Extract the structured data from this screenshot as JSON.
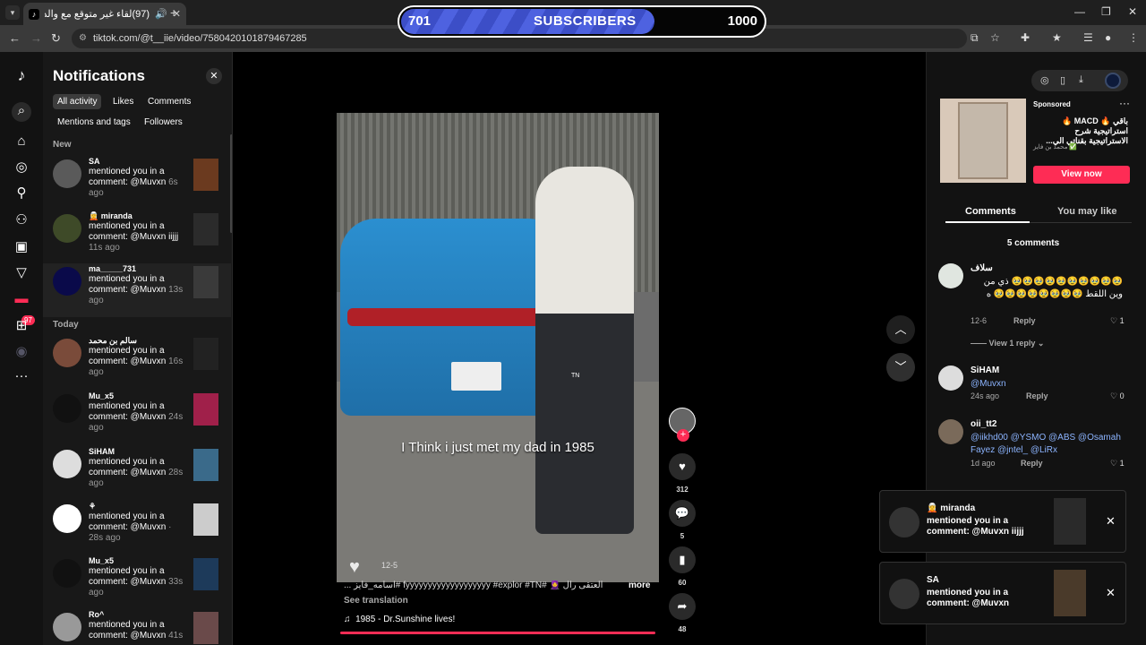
{
  "browser": {
    "tab_title": "(97)لقاء غير متوقع مع والدي",
    "url": "tiktok.com/@t__iie/video/7580420101879467285"
  },
  "subscribers": {
    "current": "701",
    "label": "SUBSCRIBERS",
    "goal": "1000",
    "progress": 0.701
  },
  "rail": {
    "badge": "97"
  },
  "notifications": {
    "title": "Notifications",
    "filters": [
      "All activity",
      "Likes",
      "Comments",
      "Mentions and tags",
      "Followers"
    ],
    "section_new": "New",
    "section_today": "Today",
    "items": [
      {
        "name": "SA",
        "text": "mentioned you in a comment: @Muvxn",
        "time": "6s ago"
      },
      {
        "name": "🧝 miranda",
        "text": "mentioned you in a comment: @Muvxn iijjj",
        "time": "11s ago"
      },
      {
        "name": "ma_____731",
        "text": "mentioned you in a comment: @Muvxn",
        "time": "13s ago"
      },
      {
        "name": "سالم بن محمد",
        "text": "mentioned you in a comment: @Muvxn",
        "time": "16s ago"
      },
      {
        "name": "Mu_x5",
        "text": "mentioned you in a comment: @Muvxn",
        "time": "24s ago"
      },
      {
        "name": "SiHAM",
        "text": "mentioned you in a comment: @Muvxn",
        "time": "28s ago"
      },
      {
        "name": "⚘",
        "text": "mentioned you in a comment: @Muvxn",
        "time": "· 28s ago"
      },
      {
        "name": "Mu_x5",
        "text": "mentioned you in a comment: @Muvxn",
        "time": "33s ago"
      },
      {
        "name": "Ro^",
        "text": "mentioned you in a comment: @Muvxn",
        "time": "41s"
      }
    ]
  },
  "video": {
    "caption": "I Think i just met my dad in 1985",
    "tn": "TN",
    "date": "12-5",
    "description": "العتقى رال 🧕 #fyyyyyyyyyyyyyyyyyyy #explor #TN #اسامه_فايز ...",
    "more": "more",
    "see_translation": "See translation",
    "music": "1985 - Dr.Sunshine lives!",
    "likes": "312",
    "comments": "5",
    "saves": "60",
    "shares": "48"
  },
  "ad": {
    "sponsored": "Sponsored",
    "text": "باقي 🔥 MACD 🔥 استراتيجية شرح الاستراتيجية بقناتي الي...",
    "author": "محمد بن فايز ✅",
    "button": "View now"
  },
  "comments_panel": {
    "tab_comments": "Comments",
    "tab_like": "You may like",
    "count_label": "5 comments",
    "reply_label": "Reply",
    "view_reply": "View 1 reply",
    "items": [
      {
        "name": "سلاف",
        "body": "🥹🥹🥹🥹🥹🥹🥹🥹🥹🥹 ذي من وين اللقط 🥹🥹🥹🥹🥹🥹🥹🥹 ه",
        "date": "12-6",
        "likes": "1"
      },
      {
        "name": "SiHAM",
        "body": "@Muvxn",
        "date": "24s ago",
        "likes": "0"
      },
      {
        "name": "oii_tt2",
        "body": "@iikhd00 @YSMO @ABS @Osamah Fayez @jntel_ @LiRx",
        "date": "1d ago",
        "likes": "1"
      }
    ]
  },
  "toasts": [
    {
      "name": "🧝 miranda",
      "text": "mentioned you in a comment: @Muvxn iijjj"
    },
    {
      "name": "SA",
      "text": "mentioned you in a comment: @Muvxn"
    }
  ]
}
